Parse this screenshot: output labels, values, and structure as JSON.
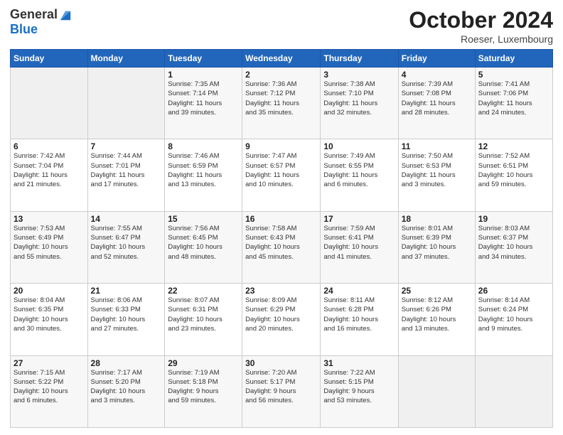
{
  "header": {
    "logo": {
      "general": "General",
      "blue": "Blue"
    },
    "title": "October 2024",
    "location": "Roeser, Luxembourg"
  },
  "weekdays": [
    "Sunday",
    "Monday",
    "Tuesday",
    "Wednesday",
    "Thursday",
    "Friday",
    "Saturday"
  ],
  "weeks": [
    [
      {
        "num": "",
        "info": ""
      },
      {
        "num": "",
        "info": ""
      },
      {
        "num": "1",
        "info": "Sunrise: 7:35 AM\nSunset: 7:14 PM\nDaylight: 11 hours\nand 39 minutes."
      },
      {
        "num": "2",
        "info": "Sunrise: 7:36 AM\nSunset: 7:12 PM\nDaylight: 11 hours\nand 35 minutes."
      },
      {
        "num": "3",
        "info": "Sunrise: 7:38 AM\nSunset: 7:10 PM\nDaylight: 11 hours\nand 32 minutes."
      },
      {
        "num": "4",
        "info": "Sunrise: 7:39 AM\nSunset: 7:08 PM\nDaylight: 11 hours\nand 28 minutes."
      },
      {
        "num": "5",
        "info": "Sunrise: 7:41 AM\nSunset: 7:06 PM\nDaylight: 11 hours\nand 24 minutes."
      }
    ],
    [
      {
        "num": "6",
        "info": "Sunrise: 7:42 AM\nSunset: 7:04 PM\nDaylight: 11 hours\nand 21 minutes."
      },
      {
        "num": "7",
        "info": "Sunrise: 7:44 AM\nSunset: 7:01 PM\nDaylight: 11 hours\nand 17 minutes."
      },
      {
        "num": "8",
        "info": "Sunrise: 7:46 AM\nSunset: 6:59 PM\nDaylight: 11 hours\nand 13 minutes."
      },
      {
        "num": "9",
        "info": "Sunrise: 7:47 AM\nSunset: 6:57 PM\nDaylight: 11 hours\nand 10 minutes."
      },
      {
        "num": "10",
        "info": "Sunrise: 7:49 AM\nSunset: 6:55 PM\nDaylight: 11 hours\nand 6 minutes."
      },
      {
        "num": "11",
        "info": "Sunrise: 7:50 AM\nSunset: 6:53 PM\nDaylight: 11 hours\nand 3 minutes."
      },
      {
        "num": "12",
        "info": "Sunrise: 7:52 AM\nSunset: 6:51 PM\nDaylight: 10 hours\nand 59 minutes."
      }
    ],
    [
      {
        "num": "13",
        "info": "Sunrise: 7:53 AM\nSunset: 6:49 PM\nDaylight: 10 hours\nand 55 minutes."
      },
      {
        "num": "14",
        "info": "Sunrise: 7:55 AM\nSunset: 6:47 PM\nDaylight: 10 hours\nand 52 minutes."
      },
      {
        "num": "15",
        "info": "Sunrise: 7:56 AM\nSunset: 6:45 PM\nDaylight: 10 hours\nand 48 minutes."
      },
      {
        "num": "16",
        "info": "Sunrise: 7:58 AM\nSunset: 6:43 PM\nDaylight: 10 hours\nand 45 minutes."
      },
      {
        "num": "17",
        "info": "Sunrise: 7:59 AM\nSunset: 6:41 PM\nDaylight: 10 hours\nand 41 minutes."
      },
      {
        "num": "18",
        "info": "Sunrise: 8:01 AM\nSunset: 6:39 PM\nDaylight: 10 hours\nand 37 minutes."
      },
      {
        "num": "19",
        "info": "Sunrise: 8:03 AM\nSunset: 6:37 PM\nDaylight: 10 hours\nand 34 minutes."
      }
    ],
    [
      {
        "num": "20",
        "info": "Sunrise: 8:04 AM\nSunset: 6:35 PM\nDaylight: 10 hours\nand 30 minutes."
      },
      {
        "num": "21",
        "info": "Sunrise: 8:06 AM\nSunset: 6:33 PM\nDaylight: 10 hours\nand 27 minutes."
      },
      {
        "num": "22",
        "info": "Sunrise: 8:07 AM\nSunset: 6:31 PM\nDaylight: 10 hours\nand 23 minutes."
      },
      {
        "num": "23",
        "info": "Sunrise: 8:09 AM\nSunset: 6:29 PM\nDaylight: 10 hours\nand 20 minutes."
      },
      {
        "num": "24",
        "info": "Sunrise: 8:11 AM\nSunset: 6:28 PM\nDaylight: 10 hours\nand 16 minutes."
      },
      {
        "num": "25",
        "info": "Sunrise: 8:12 AM\nSunset: 6:26 PM\nDaylight: 10 hours\nand 13 minutes."
      },
      {
        "num": "26",
        "info": "Sunrise: 8:14 AM\nSunset: 6:24 PM\nDaylight: 10 hours\nand 9 minutes."
      }
    ],
    [
      {
        "num": "27",
        "info": "Sunrise: 7:15 AM\nSunset: 5:22 PM\nDaylight: 10 hours\nand 6 minutes."
      },
      {
        "num": "28",
        "info": "Sunrise: 7:17 AM\nSunset: 5:20 PM\nDaylight: 10 hours\nand 3 minutes."
      },
      {
        "num": "29",
        "info": "Sunrise: 7:19 AM\nSunset: 5:18 PM\nDaylight: 9 hours\nand 59 minutes."
      },
      {
        "num": "30",
        "info": "Sunrise: 7:20 AM\nSunset: 5:17 PM\nDaylight: 9 hours\nand 56 minutes."
      },
      {
        "num": "31",
        "info": "Sunrise: 7:22 AM\nSunset: 5:15 PM\nDaylight: 9 hours\nand 53 minutes."
      },
      {
        "num": "",
        "info": ""
      },
      {
        "num": "",
        "info": ""
      }
    ]
  ]
}
